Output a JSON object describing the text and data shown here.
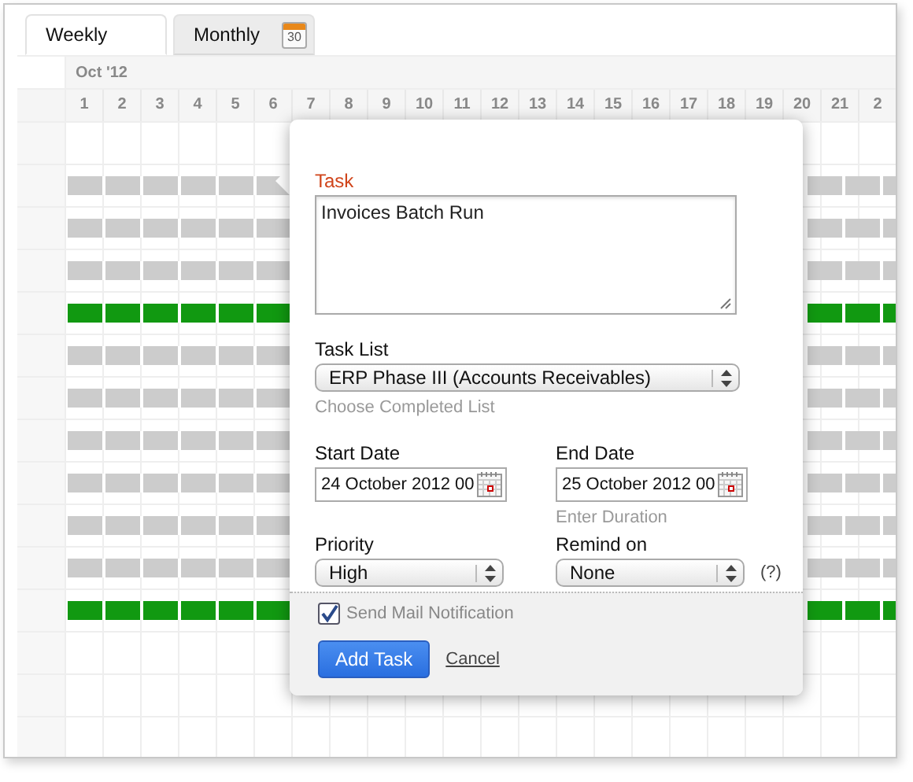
{
  "tabs": [
    {
      "label": "Weekly",
      "selected": true
    },
    {
      "label": "Monthly",
      "selected": false,
      "icon_day": "30"
    }
  ],
  "calendar": {
    "month": "Oct '12",
    "days": [
      "1",
      "2",
      "3",
      "4",
      "5",
      "6",
      "7",
      "8",
      "9",
      "10",
      "11",
      "12",
      "13",
      "14",
      "15",
      "16",
      "17",
      "18",
      "19",
      "20",
      "21",
      "2"
    ],
    "rows": [
      {
        "bar": false
      },
      {
        "bar": true,
        "color": "#cccccc"
      },
      {
        "bar": true,
        "color": "#cccccc"
      },
      {
        "bar": true,
        "color": "#cccccc"
      },
      {
        "bar": true,
        "color": "#119911"
      },
      {
        "bar": true,
        "color": "#cccccc"
      },
      {
        "bar": true,
        "color": "#cccccc"
      },
      {
        "bar": true,
        "color": "#cccccc"
      },
      {
        "bar": true,
        "color": "#cccccc"
      },
      {
        "bar": true,
        "color": "#cccccc"
      },
      {
        "bar": true,
        "color": "#cccccc"
      },
      {
        "bar": true,
        "color": "#119911"
      },
      {
        "bar": false
      },
      {
        "bar": false
      },
      {
        "bar": false
      }
    ]
  },
  "popup": {
    "task": {
      "label": "Task",
      "value": "Invoices Batch Run"
    },
    "task_list": {
      "label": "Task List",
      "value": "ERP Phase III (Accounts Receivables)",
      "hint": "Choose Completed List"
    },
    "start_date": {
      "label": "Start Date",
      "value": "24 October 2012 00"
    },
    "end_date": {
      "label": "End Date",
      "value": "25 October 2012 00",
      "hint": "Enter Duration"
    },
    "priority": {
      "label": "Priority",
      "value": "High"
    },
    "remind": {
      "label": "Remind on",
      "value": "None",
      "help": "(?)"
    },
    "send_mail": {
      "label": "Send Mail Notification",
      "checked": true
    },
    "buttons": [
      {
        "label": "Add Task",
        "kind": "primary"
      },
      {
        "label": "Cancel",
        "kind": "link"
      }
    ]
  }
}
